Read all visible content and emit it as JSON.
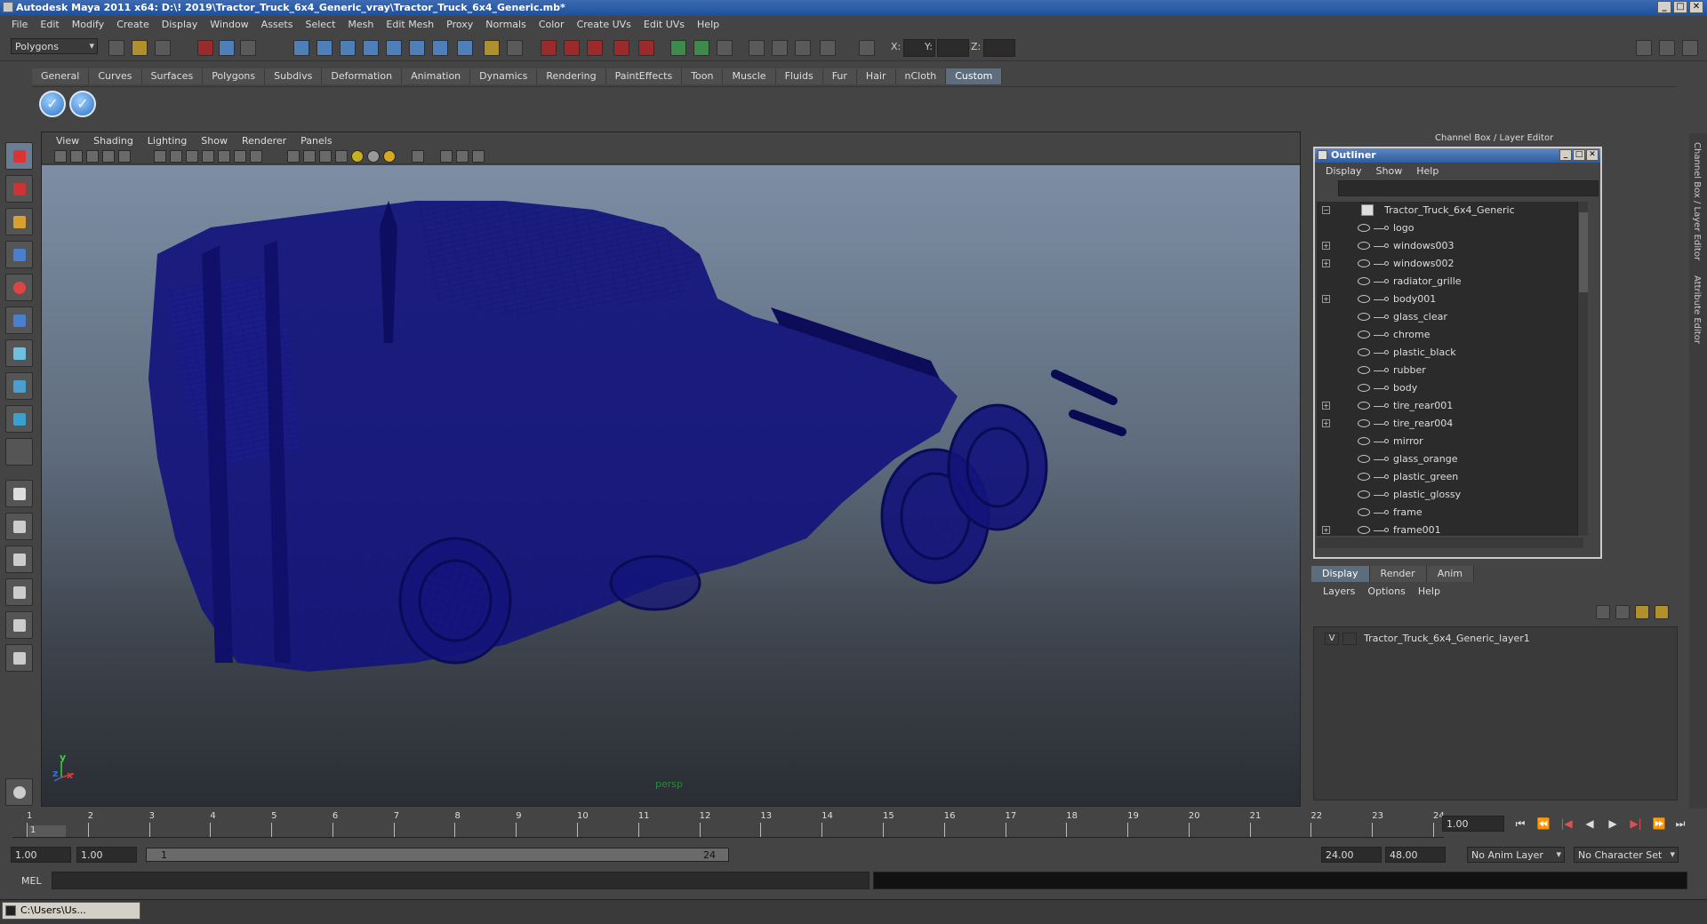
{
  "window": {
    "title": "Autodesk Maya 2011 x64: D:\\! 2019\\Tractor_Truck_6x4_Generic_vray\\Tractor_Truck_6x4_Generic.mb*",
    "min": "_",
    "max": "□",
    "close": "✕"
  },
  "menubar": [
    "File",
    "Edit",
    "Modify",
    "Create",
    "Display",
    "Window",
    "Assets",
    "Select",
    "Mesh",
    "Edit Mesh",
    "Proxy",
    "Normals",
    "Color",
    "Create UVs",
    "Edit UVs",
    "Help"
  ],
  "statusline": {
    "mode": "Polygons",
    "x_label": "X:",
    "y_label": "Y:",
    "z_label": "Z:"
  },
  "shelf": {
    "tabs": [
      "General",
      "Curves",
      "Surfaces",
      "Polygons",
      "Subdivs",
      "Deformation",
      "Animation",
      "Dynamics",
      "Rendering",
      "PaintEffects",
      "Toon",
      "Muscle",
      "Fluids",
      "Fur",
      "Hair",
      "nCloth",
      "Custom"
    ],
    "active_tab": "Custom",
    "button_glyph": "✓"
  },
  "viewport": {
    "menu": [
      "View",
      "Shading",
      "Lighting",
      "Show",
      "Renderer",
      "Panels"
    ],
    "camera": "persp",
    "axis_x": "x",
    "axis_y": "y",
    "axis_z": "z",
    "wire_color": "#14147a",
    "bg_top": "#7d8ea5",
    "bg_bottom": "#2a2d33"
  },
  "outliner": {
    "title": "Outliner",
    "menu": [
      "Display",
      "Show",
      "Help"
    ],
    "root": "Tractor_Truck_6x4_Generic",
    "items": [
      {
        "name": "logo",
        "expandable": false
      },
      {
        "name": "windows003",
        "expandable": true
      },
      {
        "name": "windows002",
        "expandable": true
      },
      {
        "name": "radiator_grille",
        "expandable": false
      },
      {
        "name": "body001",
        "expandable": true
      },
      {
        "name": "glass_clear",
        "expandable": false
      },
      {
        "name": "chrome",
        "expandable": false
      },
      {
        "name": "plastic_black",
        "expandable": false
      },
      {
        "name": "rubber",
        "expandable": false
      },
      {
        "name": "body",
        "expandable": false
      },
      {
        "name": "tire_rear001",
        "expandable": true
      },
      {
        "name": "tire_rear004",
        "expandable": true
      },
      {
        "name": "mirror",
        "expandable": false
      },
      {
        "name": "glass_orange",
        "expandable": false
      },
      {
        "name": "plastic_green",
        "expandable": false
      },
      {
        "name": "plastic_glossy",
        "expandable": false
      },
      {
        "name": "frame",
        "expandable": false
      },
      {
        "name": "frame001",
        "expandable": true
      }
    ]
  },
  "channelbox": {
    "title": "Channel Box / Layer Editor",
    "side_tab1": "Channel Box / Layer Editor",
    "side_tab2": "Attribute Editor"
  },
  "layereditor": {
    "tabs": [
      "Display",
      "Render",
      "Anim"
    ],
    "active_tab": "Display",
    "menu": [
      "Layers",
      "Options",
      "Help"
    ],
    "layer_visible": "V",
    "layer_name": "Tractor_Truck_6x4_Generic_layer1"
  },
  "timeslider": {
    "ticks": [
      "1",
      "2",
      "3",
      "4",
      "5",
      "6",
      "7",
      "8",
      "9",
      "10",
      "11",
      "12",
      "13",
      "14",
      "15",
      "16",
      "17",
      "18",
      "19",
      "20",
      "21",
      "22",
      "23",
      "24"
    ],
    "current_marker": "1",
    "current_frame": "1.00",
    "playback": [
      "⏮",
      "⏪",
      "|◀",
      "◀",
      "▶",
      "▶|",
      "⏩",
      "⏭"
    ]
  },
  "rangeslider": {
    "start": "1.00",
    "playback_start": "1.00",
    "bar_start": "1",
    "bar_end": "24",
    "playback_end": "24.00",
    "end": "48.00",
    "anim_layer": "No Anim Layer",
    "character_set": "No Character Set"
  },
  "cmdline": {
    "label": "MEL"
  },
  "taskbar": {
    "item": "C:\\Users\\Us..."
  }
}
